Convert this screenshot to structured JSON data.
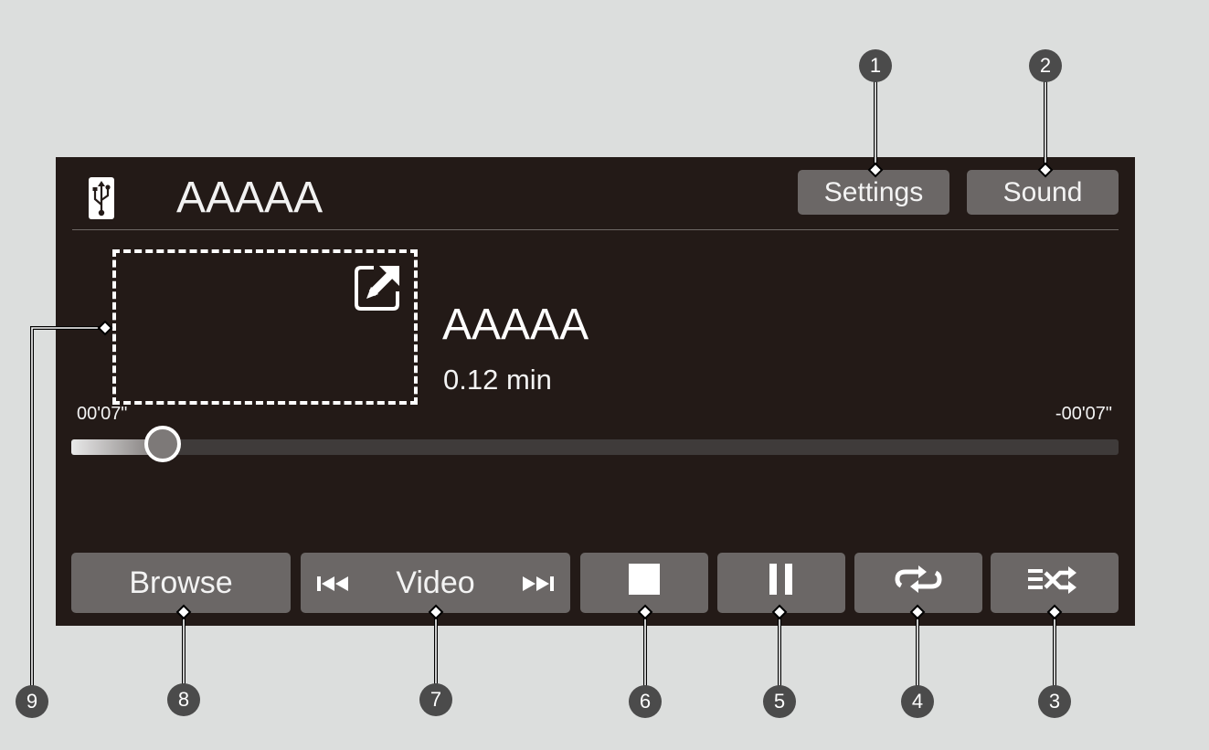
{
  "header": {
    "title": "AAAAA",
    "source_icon": "usb-icon",
    "settings_label": "Settings",
    "sound_label": "Sound"
  },
  "now_playing": {
    "album_art_action_icon": "expand-icon",
    "title": "AAAAA",
    "duration": "0.12 min",
    "time_elapsed": "00'07\"",
    "time_remaining": "-00'07\"",
    "progress": 0.087
  },
  "controls": {
    "browse_label": "Browse",
    "video_label": "Video",
    "prev_icon": "skip-previous-icon",
    "next_icon": "skip-next-icon",
    "stop_icon": "stop-icon",
    "pause_icon": "pause-icon",
    "repeat_icon": "repeat-icon",
    "shuffle_icon": "shuffle-icon"
  },
  "callouts": [
    "1",
    "2",
    "3",
    "4",
    "5",
    "6",
    "7",
    "8",
    "9"
  ],
  "colors": {
    "page_background": "#dcdedd",
    "screen_background": "#231a17",
    "button_background": "#6b6766",
    "callout_badge": "#4b4b4b"
  }
}
